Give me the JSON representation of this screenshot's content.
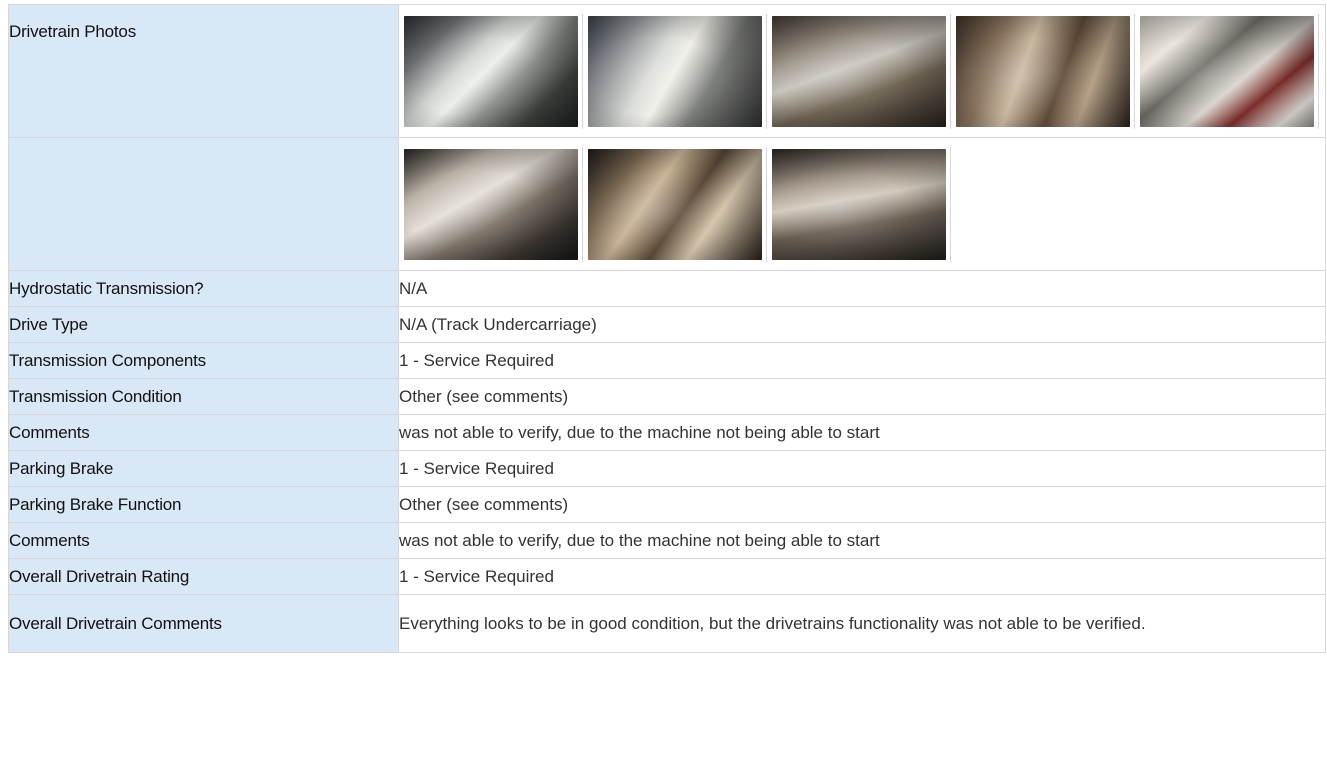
{
  "section_title_fragment": "",
  "photos": {
    "label": "Drivetrain Photos",
    "row1": [
      {
        "alt": "drivetrain photo 1"
      },
      {
        "alt": "drivetrain photo 2"
      },
      {
        "alt": "drivetrain photo 3"
      },
      {
        "alt": "drivetrain photo 4"
      },
      {
        "alt": "drivetrain photo 5"
      }
    ],
    "row2": [
      {
        "alt": "drivetrain photo 6"
      },
      {
        "alt": "drivetrain photo 7"
      },
      {
        "alt": "drivetrain photo 8"
      }
    ]
  },
  "rows": [
    {
      "label": "Hydrostatic Transmission?",
      "value": "N/A"
    },
    {
      "label": "Drive Type",
      "value": "N/A (Track Undercarriage)"
    },
    {
      "label": "Transmission Components",
      "value": "1 - Service Required"
    },
    {
      "label": "Transmission Condition",
      "value": "Other (see comments)"
    },
    {
      "label": "Comments",
      "value": "was not able to verify, due to the machine not being able to start"
    },
    {
      "label": "Parking Brake",
      "value": "1 - Service Required"
    },
    {
      "label": "Parking Brake Function",
      "value": "Other (see comments)"
    },
    {
      "label": "Comments",
      "value": "was not able to verify, due to the machine not being able to start"
    },
    {
      "label": "Overall Drivetrain Rating",
      "value": "1 - Service Required"
    },
    {
      "label": "Overall Drivetrain Comments",
      "value": "Everything looks to be in good condition, but the drivetrains functionality was not able to be verified."
    }
  ],
  "colors": {
    "label_bg": "#d8e8f7",
    "border": "#d7d7d7",
    "heading_accent": "#1a8fd6"
  }
}
